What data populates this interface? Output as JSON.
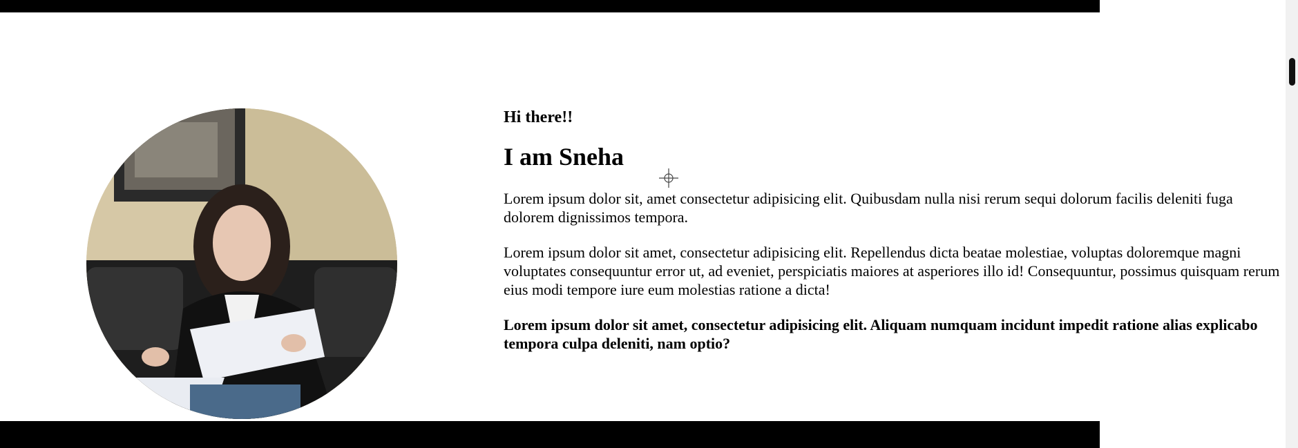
{
  "hero": {
    "greeting": "Hi there!!",
    "title": "I am Sneha",
    "paragraphs": [
      "Lorem ipsum dolor sit, amet consectetur adipisicing elit. Quibusdam nulla nisi rerum sequi dolorum facilis deleniti fuga dolorem dignissimos tempora.",
      "Lorem ipsum dolor sit amet, consectetur adipisicing elit. Repellendus dicta beatae molestiae, voluptas doloremque magni voluptates consequuntur error ut, ad eveniet, perspiciatis maiores at asperiores illo id! Consequuntur, possimus quisquam rerum eius modi tempore iure eum molestias ratione a dicta!"
    ],
    "bold_paragraph": "Lorem ipsum dolor sit amet, consectetur adipisicing elit. Aliquam numquam incidunt impedit ratione alias explicabo tempora culpa deleniti, nam optio?"
  },
  "photo": {
    "icon": "profile-photo"
  },
  "cursor": {
    "icon": "crosshair-cursor-icon"
  },
  "colors": {
    "bars": "#000000",
    "background": "#ffffff",
    "text": "#000000"
  }
}
